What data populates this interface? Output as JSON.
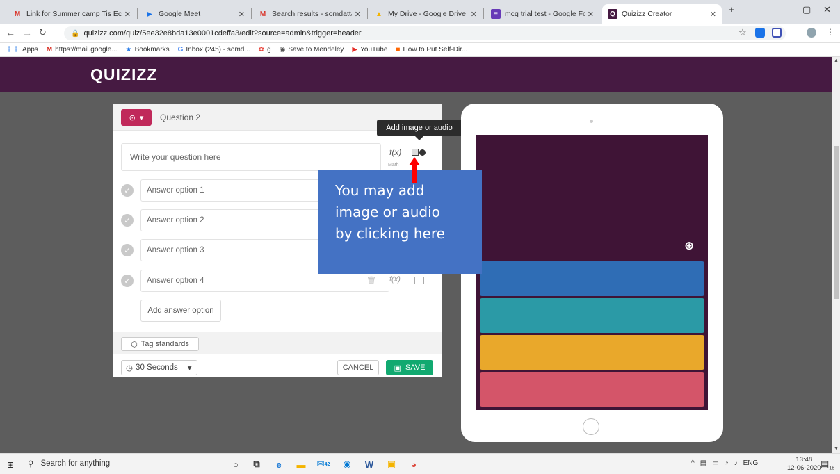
{
  "browser": {
    "tabs": [
      {
        "label": "Link for Summer camp Tis Ec",
        "favicon": "M",
        "color": "#d93025"
      },
      {
        "label": "Google Meet",
        "favicon": "▶",
        "color": "#1a73e8"
      },
      {
        "label": "Search results - somdattap@",
        "favicon": "M",
        "color": "#d93025"
      },
      {
        "label": "My Drive - Google Drive",
        "favicon": "▲",
        "color": "#f4b400"
      },
      {
        "label": "mcq trial test - Google Form",
        "favicon": "≡",
        "color": "#673ab7"
      },
      {
        "label": "Quizizz Creator",
        "favicon": "Q",
        "color": "#461a42"
      }
    ],
    "url": "quizizz.com/quiz/5ee32e8bda13e0001cdeffa3/edit?source=admin&trigger=header",
    "bookmarks": [
      "Apps",
      "https://mail.google...",
      "Bookmarks",
      "Inbox (245) - somd...",
      "g",
      "Save to Mendeley",
      "YouTube",
      "How to Put Self-Dir..."
    ]
  },
  "app": {
    "logo": "QUIZIZZ",
    "brand_color": "#461a42"
  },
  "editor": {
    "question_label": "Question 2",
    "question_placeholder": "Write your question here",
    "math_label": "Math",
    "answers": [
      "Answer option 1",
      "Answer option 2",
      "Answer option 3",
      "Answer option 4"
    ],
    "add_answer": "Add answer option",
    "tag_standards": "Tag standards",
    "timer": "30 Seconds",
    "cancel": "CANCEL",
    "save": "SAVE"
  },
  "tooltip": "Add image or audio",
  "callout": {
    "line1": "You may add",
    "line2": "image or audio",
    "line3": "by clicking here"
  },
  "preview": {
    "option_colors": [
      "#2f6db5",
      "#2b9aa6",
      "#e9a82b",
      "#d45569"
    ]
  },
  "taskbar": {
    "search": "Search for anything",
    "lang": "ENG",
    "time": "13:48",
    "date": "12-06-2020",
    "badge": "42",
    "notif": "18"
  }
}
